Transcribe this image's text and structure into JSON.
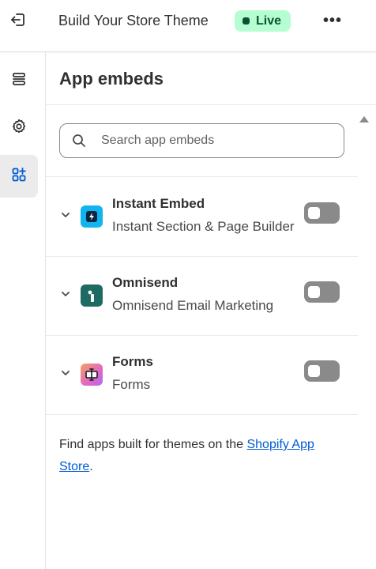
{
  "header": {
    "theme_title": "Build Your Store Theme",
    "status_badge": "Live",
    "more_label": "•••"
  },
  "rail": {
    "items": [
      {
        "name": "sections",
        "icon": "sections-icon",
        "active": false
      },
      {
        "name": "settings",
        "icon": "gear-icon",
        "active": false
      },
      {
        "name": "app-embeds",
        "icon": "apps-add-icon",
        "active": true
      }
    ]
  },
  "panel": {
    "title": "App embeds",
    "search": {
      "placeholder": "Search app embeds",
      "value": ""
    },
    "apps": [
      {
        "name": "Instant Embed",
        "subtitle": "Instant Section & Page Builder",
        "icon": "instant-embed-logo-icon",
        "icon_color": "#12b4f0",
        "enabled": false
      },
      {
        "name": "Omnisend",
        "subtitle": "Omnisend Email Marketing",
        "icon": "omnisend-logo-icon",
        "icon_color": "#1e6b63",
        "enabled": false
      },
      {
        "name": "Forms",
        "subtitle": "Forms",
        "icon": "forms-logo-icon",
        "icon_color": "#e066c8",
        "enabled": false
      }
    ],
    "footer": {
      "text_before": "Find apps built for themes on the ",
      "link_text": "Shopify App Store",
      "text_after": "."
    }
  },
  "colors": {
    "live_badge_bg": "#b4fed2",
    "live_badge_text": "#0c5132",
    "toggle_off": "#8a8a8a",
    "link": "#005bd3"
  }
}
